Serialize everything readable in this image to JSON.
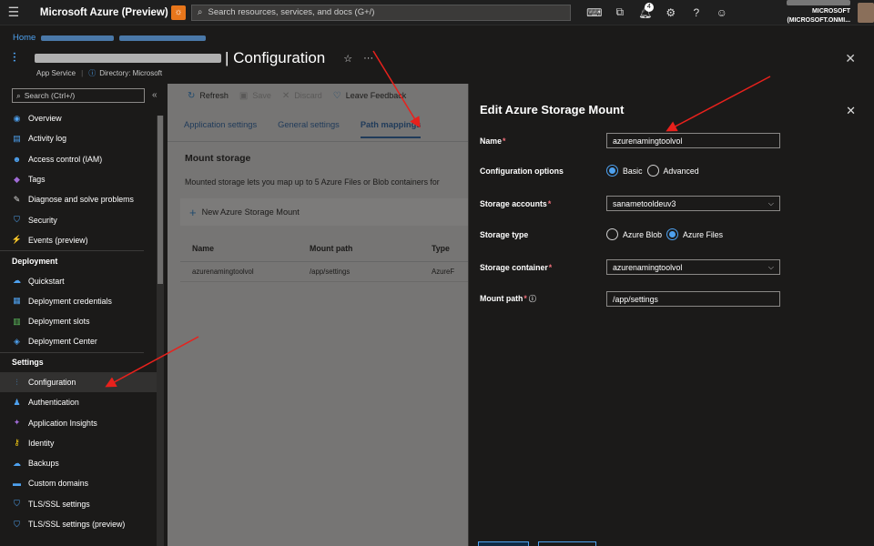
{
  "topbar": {
    "brand": "Microsoft Azure (Preview)",
    "search_placeholder": "Search resources, services, and docs (G+/)",
    "notification_count": "4",
    "account": "MICROSOFT (MICROSOFT.ONMI...",
    "icons": [
      "menu-icon",
      "bug-icon",
      "cloud-shell-icon",
      "directory-icon",
      "bell-icon",
      "gear-icon",
      "help-icon",
      "feedback-icon"
    ]
  },
  "breadcrumb": {
    "home": "Home"
  },
  "page": {
    "title": "| Configuration",
    "service": "App Service",
    "directory": "Directory: Microsoft"
  },
  "sidebar": {
    "search_placeholder": "Search (Ctrl+/)",
    "items_top": [
      {
        "label": "Overview",
        "icon": "globe-icon",
        "color": "#4ea1ef"
      },
      {
        "label": "Activity log",
        "icon": "log-icon",
        "color": "#4ea1ef"
      },
      {
        "label": "Access control (IAM)",
        "icon": "people-icon",
        "color": "#4ea1ef"
      },
      {
        "label": "Tags",
        "icon": "tag-icon",
        "color": "#a06bd6"
      },
      {
        "label": "Diagnose and solve problems",
        "icon": "wrench-icon",
        "color": "#ddd"
      },
      {
        "label": "Security",
        "icon": "shield-icon",
        "color": "#4ea1ef"
      },
      {
        "label": "Events (preview)",
        "icon": "lightning-icon",
        "color": "#f2c811"
      }
    ],
    "deployment_header": "Deployment",
    "items_deployment": [
      {
        "label": "Quickstart",
        "icon": "cloud-icon",
        "color": "#4ea1ef"
      },
      {
        "label": "Deployment credentials",
        "icon": "credentials-icon",
        "color": "#4ea1ef"
      },
      {
        "label": "Deployment slots",
        "icon": "slots-icon",
        "color": "#5ec05e"
      },
      {
        "label": "Deployment Center",
        "icon": "cube-icon",
        "color": "#4ea1ef"
      }
    ],
    "settings_header": "Settings",
    "items_settings": [
      {
        "label": "Configuration",
        "icon": "config-icon",
        "color": "#4ea1ef",
        "active": true
      },
      {
        "label": "Authentication",
        "icon": "person-key-icon",
        "color": "#4ea1ef"
      },
      {
        "label": "Application Insights",
        "icon": "insights-icon",
        "color": "#a06bd6"
      },
      {
        "label": "Identity",
        "icon": "identity-icon",
        "color": "#f2c811"
      },
      {
        "label": "Backups",
        "icon": "backups-icon",
        "color": "#4ea1ef"
      },
      {
        "label": "Custom domains",
        "icon": "domain-icon",
        "color": "#4ea1ef"
      },
      {
        "label": "TLS/SSL settings",
        "icon": "shield-icon",
        "color": "#4ea1ef"
      },
      {
        "label": "TLS/SSL settings (preview)",
        "icon": "shield-icon",
        "color": "#4ea1ef"
      }
    ]
  },
  "toolbar": {
    "refresh": "Refresh",
    "save": "Save",
    "discard": "Discard",
    "feedback": "Leave Feedback"
  },
  "tabs": [
    "Application settings",
    "General settings",
    "Path mappings"
  ],
  "mount": {
    "title": "Mount storage",
    "description": "Mounted storage lets you map up to 5 Azure Files or Blob containers for",
    "new_button": "New Azure Storage Mount",
    "columns": [
      "Name",
      "Mount path",
      "Type"
    ],
    "rows": [
      {
        "name": "azurenamingtoolvol",
        "path": "/app/settings",
        "type": "AzureF"
      }
    ]
  },
  "panel": {
    "title": "Edit Azure Storage Mount",
    "name_label": "Name",
    "name_value": "azurenamingtoolvol",
    "config_label": "Configuration options",
    "config_basic": "Basic",
    "config_advanced": "Advanced",
    "account_label": "Storage accounts",
    "account_value": "sanametooldeuv3",
    "type_label": "Storage type",
    "type_blob": "Azure Blob",
    "type_files": "Azure Files",
    "container_label": "Storage container",
    "container_value": "azurenamingtoolvol",
    "mountpath_label": "Mount path",
    "mountpath_value": "/app/settings",
    "required": "*"
  },
  "colors": {
    "accent": "#4ea1ef",
    "arrow": "#e8211c",
    "required": "#f1707b"
  }
}
